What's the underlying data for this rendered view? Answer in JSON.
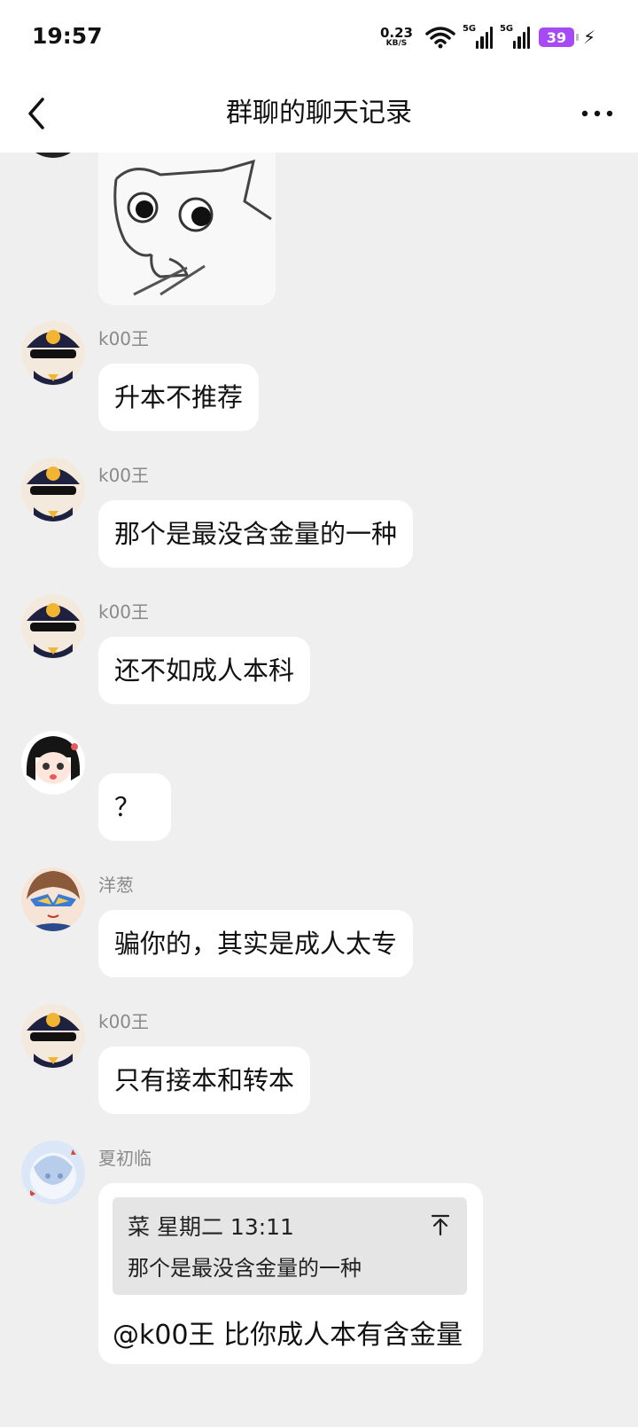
{
  "status_bar": {
    "time": "19:57",
    "net_speed_value": "0.23",
    "net_speed_unit": "KB/S",
    "sim1_label": "5G",
    "sim2_label": "5G",
    "battery_level": "39",
    "battery_color": "#a64bf4"
  },
  "header": {
    "title": "群聊的聊天记录",
    "back_icon": "chevron-left-icon",
    "more_icon": "more-horizontal-icon"
  },
  "messages": [
    {
      "sender": "k00王",
      "text": "升本不推荐"
    },
    {
      "sender": "k00王",
      "text": "那个是最没含金量的一种"
    },
    {
      "sender": "k00王",
      "text": "还不如成人本科"
    },
    {
      "sender": "",
      "text": "？"
    },
    {
      "sender": "洋葱",
      "text": "骗你的，其实是成人太专"
    },
    {
      "sender": "k00王",
      "text": "只有接本和转本"
    },
    {
      "sender": "夏初临",
      "quote": {
        "author": "菜",
        "time": "星期二 13:11",
        "text": "那个是最没含金量的一种"
      },
      "text": "@k00王 比你成人本有含金量"
    }
  ],
  "colors": {
    "chat_background": "#efefef",
    "bubble": "#ffffff",
    "sender_name": "#8a8a8a",
    "quote_background": "#e5e5e5"
  }
}
